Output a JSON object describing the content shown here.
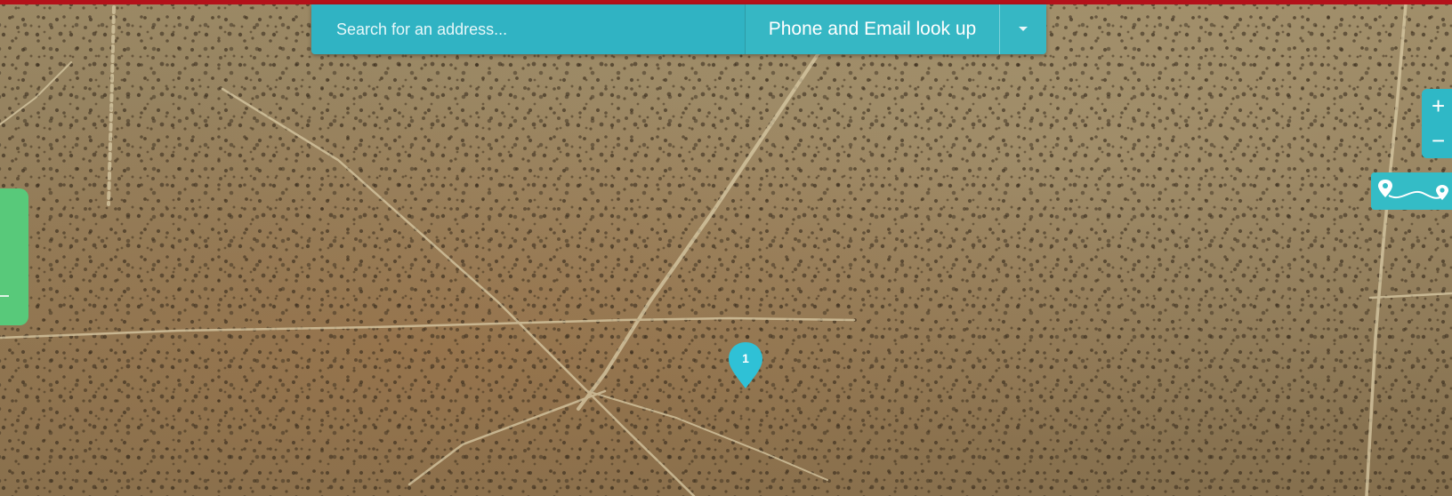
{
  "search": {
    "placeholder": "Search for an address...",
    "lookup_label": "Phone and Email look up",
    "dropdown_icon": "caret-down-icon"
  },
  "map": {
    "type": "satellite",
    "marker": {
      "label": "1",
      "color": "#2fc1d6"
    }
  },
  "zoom": {
    "in_label": "+",
    "out_label": "−"
  },
  "route": {
    "icon": "route-icon"
  },
  "colors": {
    "accent": "#2fb8c6",
    "top_bar": "#b3121a",
    "side_tab": "#58c97a"
  }
}
